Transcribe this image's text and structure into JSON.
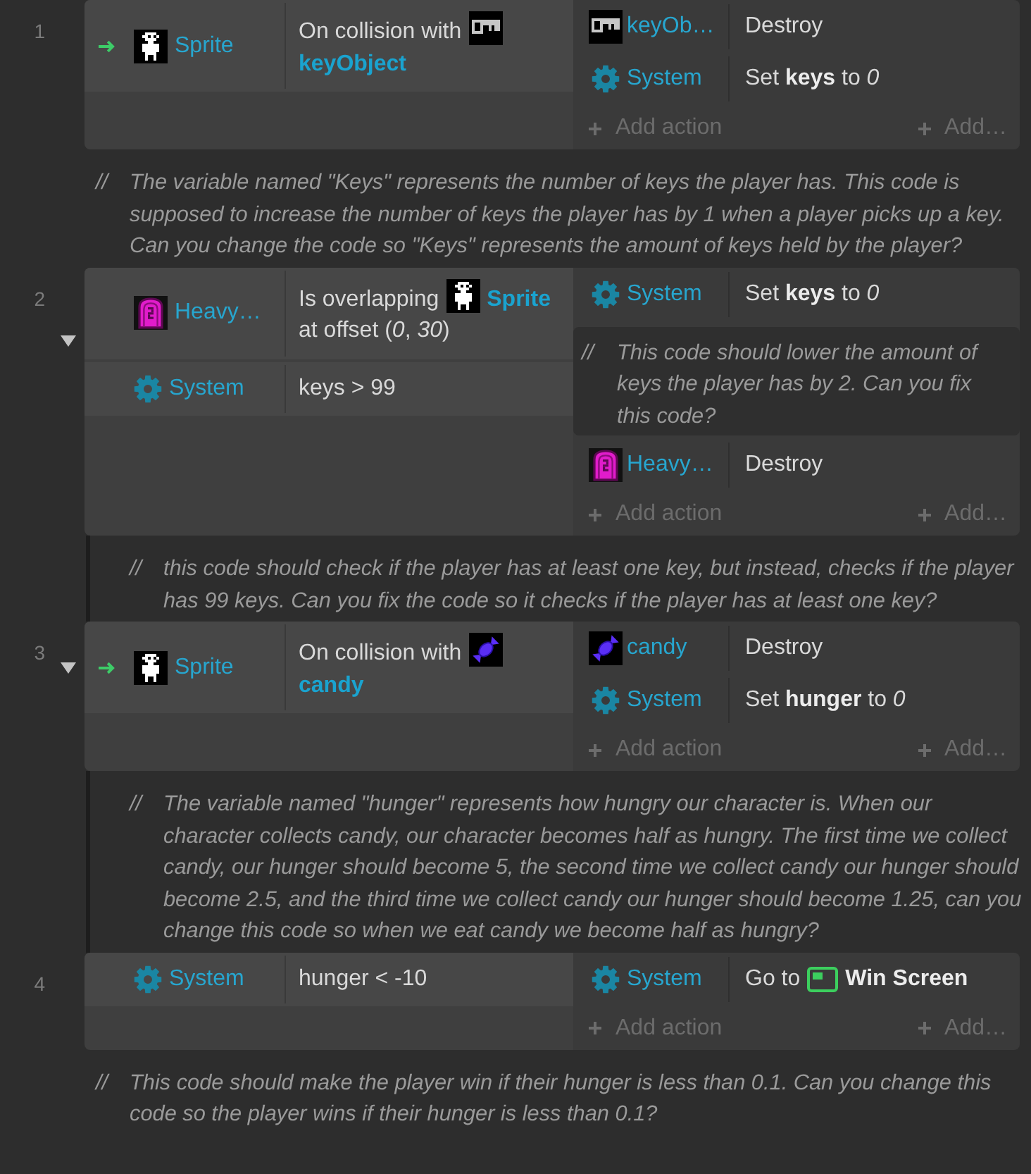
{
  "event_sheet": [
    {
      "kind": "event",
      "number": "1",
      "conditions": [
        {
          "trigger": true,
          "object": {
            "kind": "sprite",
            "name": "Sprite"
          },
          "parts": [
            {
              "kind": "text",
              "text": "On collision with"
            },
            {
              "kind": "key",
              "name": "keyObject"
            }
          ]
        }
      ],
      "actions": [
        {
          "kind": "action",
          "object": {
            "kind": "key",
            "name": "keyOb…"
          },
          "parts": [
            {
              "kind": "text",
              "text": "Destroy"
            }
          ]
        },
        {
          "kind": "action",
          "object": {
            "kind": "system",
            "name": "System"
          },
          "parts": [
            {
              "kind": "text",
              "text": "Set **keys** to *0*"
            }
          ]
        }
      ],
      "add_action": "Add action",
      "add_more": "Add…"
    },
    {
      "kind": "comment",
      "prefix": "//",
      "text": "The variable named \"Keys\" represents the number of keys the player has. This code is supposed to increase the number of keys the player has by 1 when a player picks up a key. Can you change the code so \"Keys\" represents the amount of keys held by the player?"
    },
    {
      "kind": "event",
      "number": "2",
      "expanded": true,
      "conditions": [
        {
          "trigger": false,
          "object": {
            "kind": "tombstone",
            "name": "Heavy…"
          },
          "parts": [
            {
              "kind": "text",
              "text": "Is overlapping"
            },
            {
              "kind": "sprite",
              "name": "Sprite"
            },
            {
              "kind": "text",
              "text": "at offset (*0*, *30*)"
            }
          ]
        },
        {
          "trigger": false,
          "object": {
            "kind": "system",
            "name": "System"
          },
          "parts": [
            {
              "kind": "text",
              "text": "keys > 99"
            }
          ]
        }
      ],
      "actions": [
        {
          "kind": "action",
          "object": {
            "kind": "system",
            "name": "System"
          },
          "parts": [
            {
              "kind": "text",
              "text": "Set **keys** to *0*"
            }
          ]
        },
        {
          "kind": "comment",
          "prefix": "//",
          "text": "This code should lower the amount of keys the player has by 2. Can you fix this code?"
        },
        {
          "kind": "action",
          "object": {
            "kind": "tombstone",
            "name": "Heavy…"
          },
          "parts": [
            {
              "kind": "text",
              "text": "Destroy"
            }
          ]
        }
      ],
      "add_action": "Add action",
      "add_more": "Add…",
      "children": [
        {
          "kind": "comment",
          "prefix": "//",
          "text": "this code should check if the player has at least one key, but instead, checks if the player has 99 keys. Can you fix the code so it checks if the player has at least one key?"
        }
      ]
    },
    {
      "kind": "event",
      "number": "3",
      "expanded": true,
      "conditions": [
        {
          "trigger": true,
          "object": {
            "kind": "sprite",
            "name": "Sprite"
          },
          "parts": [
            {
              "kind": "text",
              "text": "On collision with"
            },
            {
              "kind": "candy",
              "name": "candy"
            }
          ]
        }
      ],
      "actions": [
        {
          "kind": "action",
          "object": {
            "kind": "candy",
            "name": "candy"
          },
          "parts": [
            {
              "kind": "text",
              "text": "Destroy"
            }
          ]
        },
        {
          "kind": "action",
          "object": {
            "kind": "system",
            "name": "System"
          },
          "parts": [
            {
              "kind": "text",
              "text": "Set **hunger** to *0*"
            }
          ]
        }
      ],
      "add_action": "Add action",
      "add_more": "Add…",
      "children": [
        {
          "kind": "comment",
          "prefix": "//",
          "text": "The variable named \"hunger\" represents how hungry our character is. When our character collects candy, our character becomes half as hungry. The first time we collect candy, our hunger should become 5, the second time we collect candy our hunger should become 2.5, and the third time we collect candy our hunger should become 1.25, can you change this code so when we eat candy we become half as hungry?"
        }
      ]
    },
    {
      "kind": "event",
      "number": "4",
      "conditions": [
        {
          "trigger": false,
          "object": {
            "kind": "system",
            "name": "System"
          },
          "parts": [
            {
              "kind": "text",
              "text": "hunger < -10"
            }
          ]
        }
      ],
      "actions": [
        {
          "kind": "action",
          "object": {
            "kind": "system",
            "name": "System"
          },
          "parts": [
            {
              "kind": "text",
              "text": "Go to"
            },
            {
              "kind": "layout",
              "name": "Win Screen"
            }
          ]
        }
      ],
      "add_action": "Add action",
      "add_more": "Add…"
    },
    {
      "kind": "comment",
      "prefix": "//",
      "text": "This code should make the player win if their hunger is less than 0.1. Can you change this code so the player wins if their hunger is less than 0.1?"
    }
  ]
}
